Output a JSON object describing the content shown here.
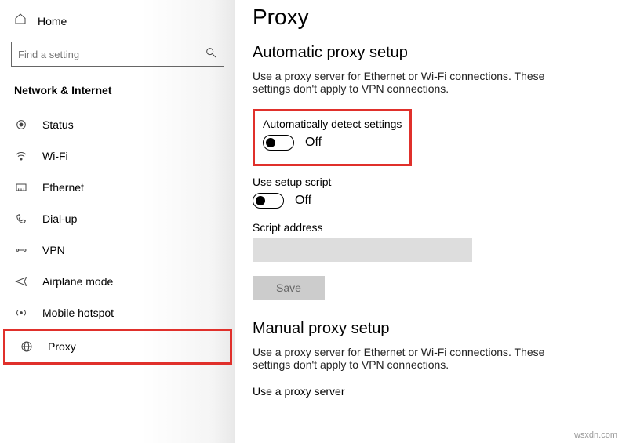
{
  "sidebar": {
    "home_label": "Home",
    "search_placeholder": "Find a setting",
    "section": "Network & Internet",
    "items": [
      {
        "label": "Status"
      },
      {
        "label": "Wi-Fi"
      },
      {
        "label": "Ethernet"
      },
      {
        "label": "Dial-up"
      },
      {
        "label": "VPN"
      },
      {
        "label": "Airplane mode"
      },
      {
        "label": "Mobile hotspot"
      },
      {
        "label": "Proxy"
      }
    ]
  },
  "main": {
    "title": "Proxy",
    "auto": {
      "heading": "Automatic proxy setup",
      "desc": "Use a proxy server for Ethernet or Wi-Fi connections. These settings don't apply to VPN connections.",
      "auto_detect_label": "Automatically detect settings",
      "auto_detect_state": "Off",
      "setup_script_label": "Use setup script",
      "setup_script_state": "Off",
      "script_address_label": "Script address",
      "save_label": "Save"
    },
    "manual": {
      "heading": "Manual proxy setup",
      "desc": "Use a proxy server for Ethernet or Wi-Fi connections. These settings don't apply to VPN connections.",
      "use_proxy_label": "Use a proxy server"
    }
  },
  "watermark": "wsxdn.com"
}
